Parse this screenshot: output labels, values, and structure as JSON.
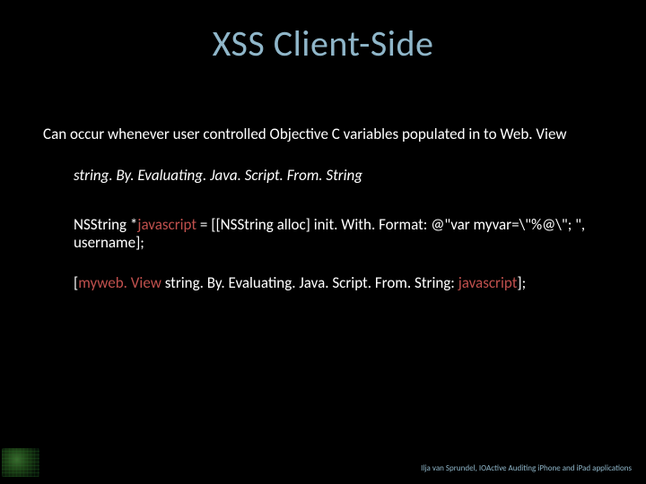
{
  "title": "XSS Client-Side",
  "body": {
    "intro": "Can occur whenever user controlled Objective C variables populated in to Web. View",
    "api": "string. By. Evaluating. Java. Script. From. String",
    "code1_a": "NSString *",
    "code1_js": "javascript",
    "code1_b": " = [[NSString alloc] init. With. Format: @\"var myvar=\\\"%@\\\"; \", username];",
    "code2_a": "[",
    "code2_obj": "myweb. View",
    "code2_b": " string. By. Evaluating. Java. Script. From. String: ",
    "code2_arg": "javascript",
    "code2_c": "];"
  },
  "attribution": "Ilja van Sprundel, IOActive Auditing iPhone and iPad applications"
}
